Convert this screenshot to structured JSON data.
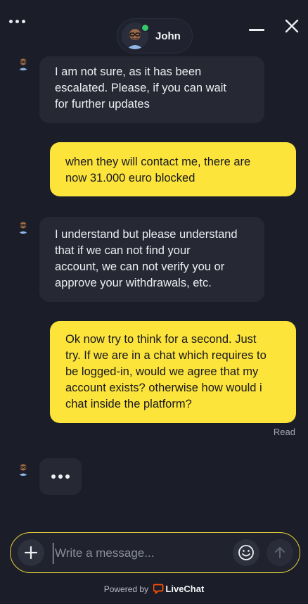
{
  "header": {
    "menu_icon": "more-horizontal-icon",
    "agent_name": "John",
    "status_color": "#37c86b",
    "minimize_icon": "minimize-icon",
    "close_icon": "close-icon"
  },
  "messages": [
    {
      "author": "agent",
      "lines": [
        "I am not sure, as it has been",
        "escalated. Please, if you can wait",
        "for further updates"
      ]
    },
    {
      "author": "user",
      "lines": [
        "when they will contact me, there are",
        "now 31.000 euro blocked"
      ]
    },
    {
      "author": "agent",
      "lines": [
        "I understand but please understand",
        "that if we can not find your",
        "account, we can not verify you or",
        "approve your withdrawals, etc."
      ]
    },
    {
      "author": "user",
      "lines": [
        "Ok now try to think for a second. Just",
        "try. If we are in a chat which requires to",
        "be logged-in, would we agree that my",
        "account exists? otherwise how would i",
        "chat inside the platform?"
      ]
    }
  ],
  "read_status": "Read",
  "composer": {
    "placeholder": "Write a message...",
    "value": "",
    "add_icon": "plus-icon",
    "emoji_icon": "emoji-icon",
    "send_icon": "send-arrow-icon"
  },
  "footer": {
    "powered_by": "Powered by",
    "brand": "LiveChat"
  },
  "colors": {
    "background": "#1b1d29",
    "agent_bubble": "#262834",
    "user_bubble": "#fde43b",
    "accent_border": "#e9d13b",
    "brand_icon": "#ff5100"
  }
}
